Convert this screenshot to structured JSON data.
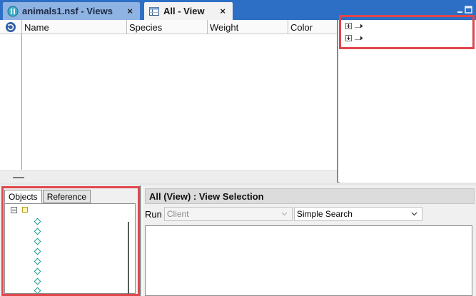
{
  "tabs": [
    {
      "label": "animals1.nsf - Views",
      "icon": "database-icon",
      "active": false
    },
    {
      "label": "All - View",
      "icon": "view-icon",
      "active": true
    }
  ],
  "tab_close_glyph": "×",
  "view": {
    "columns": [
      "Name",
      "Species",
      "Weight",
      "Color"
    ]
  },
  "objects_panel": {
    "tabs": [
      "Objects",
      "Reference"
    ],
    "active_tab": "Objects"
  },
  "programmer": {
    "title": "All (View) : View Selection",
    "run_label": "Run",
    "run_target": "Client",
    "search_type": "Simple Search"
  },
  "colors": {
    "tabbar": "#2d6fc4",
    "highlight": "#e0474c",
    "diamond": "#1c9a8e"
  }
}
